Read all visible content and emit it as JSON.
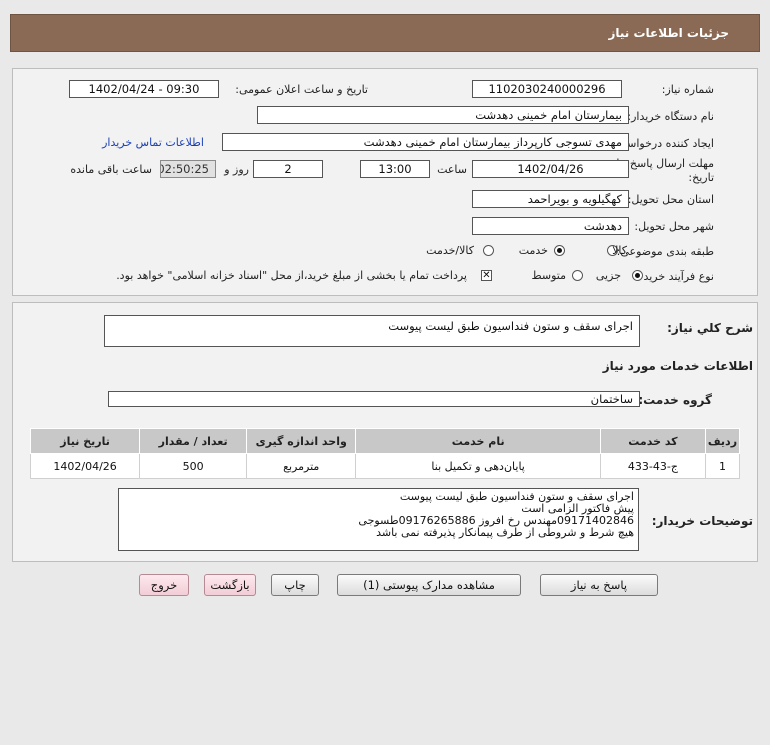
{
  "header": {
    "title": "جزئیات اطلاعات نیاز"
  },
  "form": {
    "need_number_label": "شماره نیاز:",
    "need_number": "1102030240000296",
    "announce_label": "تاریخ و ساعت اعلان عمومی:",
    "announce_value": "1402/04/24 - 09:30",
    "buyer_label": "نام دستگاه خریدار:",
    "buyer_value": "بیمارستان امام خمینی دهدشت",
    "creator_label": "ایجاد کننده درخواست:",
    "creator_value": "مهدی تسوجی کارپرداز بیمارستان امام خمینی دهدشت",
    "contact_link": "اطلاعات تماس خریدار",
    "deadline_label_1": "مهلت ارسال پاسخ: تا",
    "deadline_label_2": "تاریخ:",
    "deadline_date": "1402/04/26",
    "hour_label": "ساعت",
    "deadline_time": "13:00",
    "days_value": "2",
    "days_label": "روز و",
    "timer_value": "02:50:25",
    "remaining_label": "ساعت باقی مانده",
    "province_label": "استان محل تحویل:",
    "province_value": "کهگیلویه و بویراحمد",
    "city_label": "شهر محل تحویل:",
    "city_value": "دهدشت",
    "category_label": "طبقه بندی موضوعی:",
    "cat_goods": "کالا",
    "cat_service": "خدمت",
    "cat_both": "کالا/خدمت",
    "process_label": "نوع فرآیند خرید :",
    "proc_minor": "جزیی",
    "proc_medium": "متوسط",
    "proc_check_text": "پرداخت تمام یا بخشی از مبلغ خرید،از محل \"اسناد خزانه اسلامی\" خواهد بود.",
    "check_mark": "✕"
  },
  "description": {
    "label": "شرح کلي نياز:",
    "value": "اجرای سقف و ستون فنداسیون طبق لیست پیوست"
  },
  "services": {
    "section_title": "اطلاعات خدمات مورد نیاز",
    "group_label": "گروه خدمت:",
    "group_value": "ساختمان",
    "columns": [
      "ردیف",
      "کد خدمت",
      "نام خدمت",
      "واحد اندازه گیری",
      "تعداد / مقدار",
      "تاریخ نیاز"
    ],
    "rows": [
      {
        "index": "1",
        "code": "ج-43-433",
        "name": "پایان‌دهی و تکمیل بنا",
        "unit": "مترمربع",
        "qty": "500",
        "date": "1402/04/26"
      }
    ]
  },
  "notes": {
    "label": "توضیحات خریدار:",
    "lines": [
      "اجرای سقف و ستون فنداسیون طبق لیست پیوست",
      "پیش فاکتور الزامی است",
      "09171402846مهندس رخ افروز 09176265886طسوجی",
      "هیچ شرط و شروطی از طرف پیمانکار پذیرفته نمی باشد"
    ]
  },
  "buttons": {
    "reply": "پاسخ به نیاز",
    "attachments": "مشاهده مدارک پیوستی (1)",
    "print": "چاپ",
    "back": "بازگشت",
    "exit": "خروج"
  },
  "colors": {
    "header_bg": "#8a6a55",
    "link": "#1a3fb5",
    "exit_btn": "#f2cdd6"
  }
}
